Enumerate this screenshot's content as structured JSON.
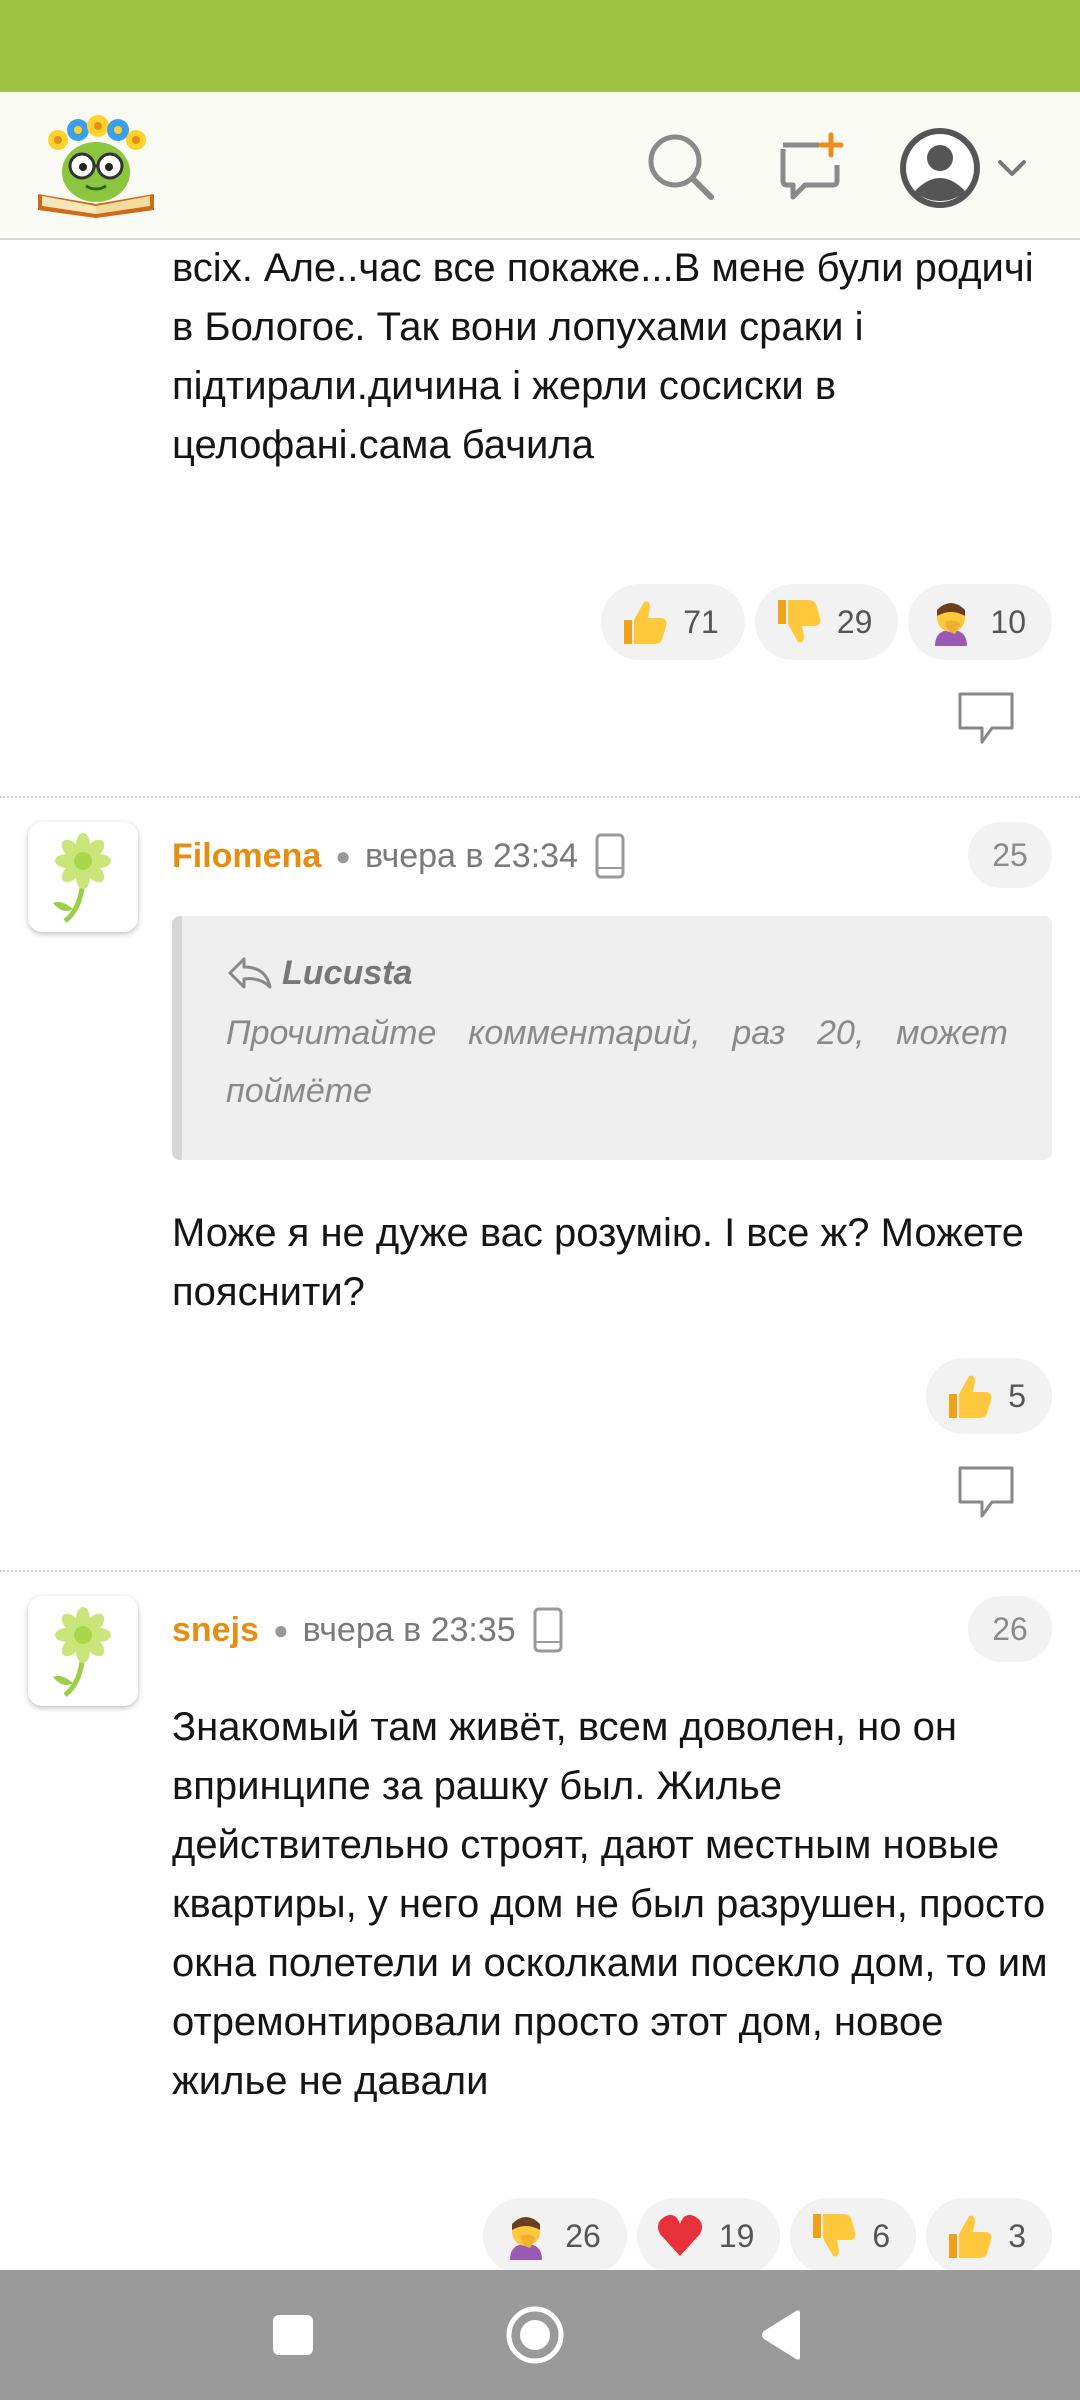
{
  "header": {
    "logo_name": "site-logo",
    "icons": [
      "search-icon",
      "new-post-icon",
      "avatar-icon",
      "chevron-down-icon"
    ]
  },
  "comments": [
    {
      "partial_top": true,
      "text": "палки під лопухом. Маріуполь це показуха для всіх. Але..час все покаже...В мене були родичі в Бологоє. Так вони лопухами сраки і підтирали.дичина і жерли сосиски в целофані.сама бачила",
      "reactions": [
        {
          "emoji": "thumbs-up",
          "count": "71"
        },
        {
          "emoji": "thumbs-down",
          "count": "29"
        },
        {
          "emoji": "facepalm",
          "count": "10"
        }
      ]
    },
    {
      "author": "Filomena",
      "time": "вчера в 23:34",
      "number": "25",
      "quote": {
        "author": "Lucusta",
        "text": "Прочитайте комментарий, раз 20, может поймёте"
      },
      "text": "Може я не дуже вас розумію. І все ж? Можете пояснити?",
      "reactions": [
        {
          "emoji": "thumbs-up",
          "count": "5"
        }
      ]
    },
    {
      "author": "snejs",
      "time": "вчера в 23:35",
      "number": "26",
      "text": "Знакомый там живёт, всем доволен, но он впринципе за рашку был. Жилье действительно строят, дают местным новые квартиры, у него дом не был разрушен, просто окна полетели и осколками посекло дом, то им отремонтировали просто этот дом, новое жилье не давали",
      "reactions": [
        {
          "emoji": "facepalm",
          "count": "26"
        },
        {
          "emoji": "heart",
          "count": "19"
        },
        {
          "emoji": "thumbs-down",
          "count": "6"
        },
        {
          "emoji": "thumbs-up",
          "count": "3"
        }
      ]
    }
  ],
  "colors": {
    "status_bar": "#9dc244",
    "author": "#e58e12",
    "nav_bar": "#9a9a9a"
  }
}
